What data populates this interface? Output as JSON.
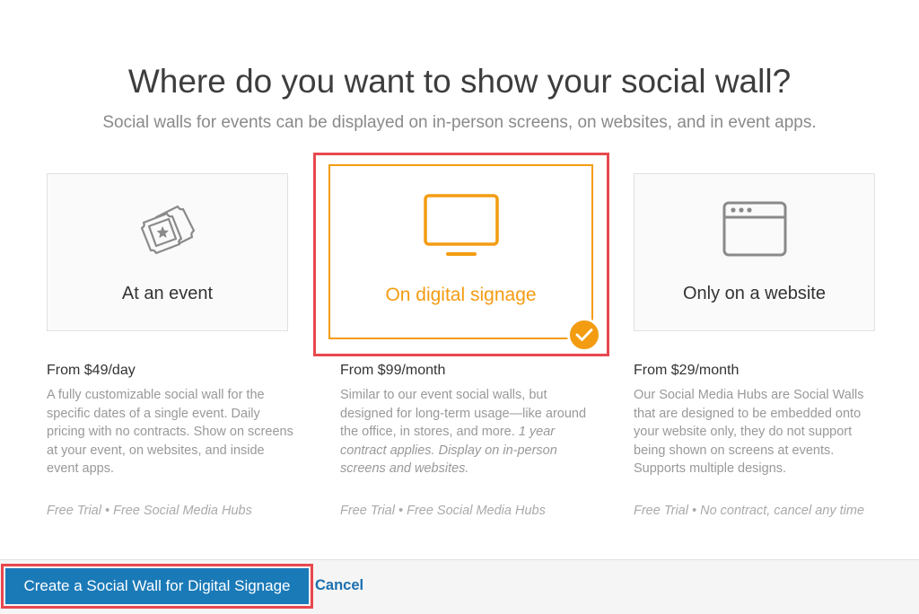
{
  "header": {
    "title": "Where do you want to show your social wall?",
    "subtitle": "Social walls for events can be displayed on in-person screens, on websites, and in event apps."
  },
  "options": [
    {
      "label": "At an event",
      "icon": "ticket-icon",
      "price": "From $49/day",
      "description": "A fully customizable social wall for the specific dates of a single event. Daily pricing with no contracts. Show on screens at your event, on websites, and inside event apps.",
      "description_italic": "",
      "footnote": "Free Trial • Free Social Media Hubs",
      "selected": false
    },
    {
      "label": "On digital signage",
      "icon": "monitor-icon",
      "price": "From $99/month",
      "description": "Similar to our event social walls, but designed for long-term usage—like around the office, in stores, and more.",
      "description_italic": "1 year contract applies. Display on in-person screens and websites.",
      "footnote": "Free Trial • Free Social Media Hubs",
      "selected": true
    },
    {
      "label": "Only on a website",
      "icon": "browser-window-icon",
      "price": "From $29/month",
      "description": "Our Social Media Hubs are Social Walls that are designed to be embedded onto your website only, they do not support being shown on screens at events. Supports multiple designs.",
      "description_italic": "",
      "footnote": "Free Trial • No contract, cancel any time",
      "selected": false
    }
  ],
  "footer": {
    "primary_label": "Create a Social Wall for Digital Signage",
    "cancel_label": "Cancel"
  },
  "colors": {
    "accent": "#f39c12",
    "primary": "#1a7ab8",
    "highlight": "#e8484f"
  }
}
